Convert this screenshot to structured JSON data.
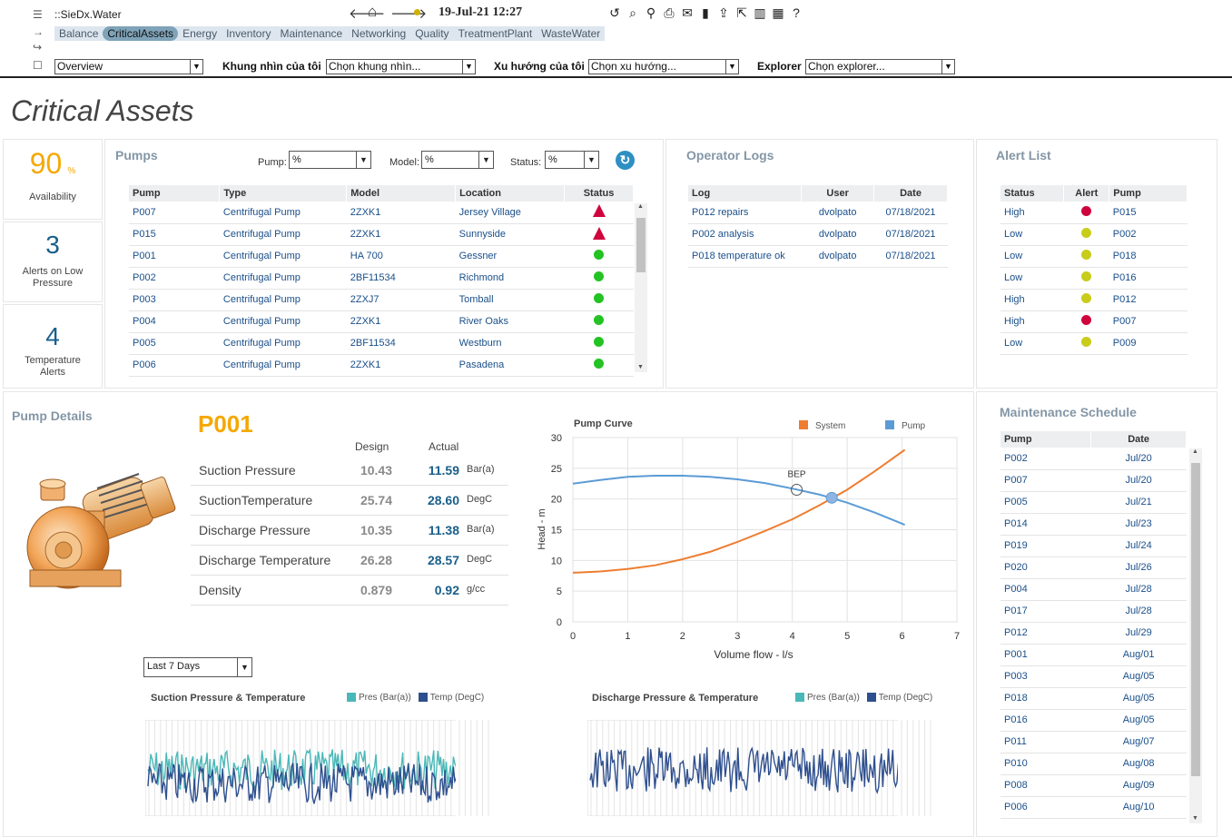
{
  "app": {
    "title": "::SieDx.Water",
    "datetime": "19-Jul-21 12:27"
  },
  "tabs": [
    "Balance",
    "CriticalAssets",
    "Energy",
    "Inventory",
    "Maintenance",
    "Networking",
    "Quality",
    "TreatmentPlant",
    "WasteWater"
  ],
  "active_tab": "CriticalAssets",
  "toolbar_icons": [
    "undo-icon",
    "search-zoom-icon",
    "pin-icon",
    "print-icon",
    "mail-icon",
    "trash-icon",
    "upload-icon",
    "export-icon",
    "chart-icon",
    "grid-icon",
    "help-icon"
  ],
  "selectors": {
    "view": "Overview",
    "my_view_label": "Khung nhìn của tôi",
    "my_view": "Chọn khung nhìn...",
    "trend_label": "Xu hướng của tôi",
    "trend": "Chọn xu hướng...",
    "explorer_label": "Explorer",
    "explorer": "Chọn explorer..."
  },
  "page_title": "Critical Assets",
  "kpis": [
    {
      "value": "90",
      "unit": "%",
      "label": "Availability",
      "color": "#f5a800"
    },
    {
      "value": "3",
      "label": "Alerts on Low Pressure",
      "color": "#1a5f8a"
    },
    {
      "value": "4",
      "label": "Temperature Alerts",
      "color": "#1a5f8a"
    }
  ],
  "pumps": {
    "title": "Pumps",
    "filters": {
      "pump_label": "Pump:",
      "pump": "%",
      "model_label": "Model:",
      "model": "%",
      "status_label": "Status:",
      "status": "%"
    },
    "columns": [
      "Pump",
      "Type",
      "Model",
      "Location",
      "Status"
    ],
    "rows": [
      [
        "P007",
        "Centrifugal Pump",
        "2ZXK1",
        "Jersey Village",
        "alert"
      ],
      [
        "P015",
        "Centrifugal Pump",
        "2ZXK1",
        "Sunnyside",
        "alert"
      ],
      [
        "P001",
        "Centrifugal Pump",
        "HA 700",
        "Gessner",
        "ok"
      ],
      [
        "P002",
        "Centrifugal Pump",
        "2BF11534",
        "Richmond",
        "ok"
      ],
      [
        "P003",
        "Centrifugal Pump",
        "2ZXJ7",
        "Tomball",
        "ok"
      ],
      [
        "P004",
        "Centrifugal Pump",
        "2ZXK1",
        "River Oaks",
        "ok"
      ],
      [
        "P005",
        "Centrifugal Pump",
        "2BF11534",
        "Westburn",
        "ok"
      ],
      [
        "P006",
        "Centrifugal Pump",
        "2ZXK1",
        "Pasadena",
        "ok"
      ]
    ]
  },
  "operator_logs": {
    "title": "Operator Logs",
    "columns": [
      "Log",
      "User",
      "Date"
    ],
    "rows": [
      [
        "P012 repairs",
        "dvolpato",
        "07/18/2021"
      ],
      [
        "P002 analysis",
        "dvolpato",
        "07/18/2021"
      ],
      [
        "P018 temperature ok",
        "dvolpato",
        "07/18/2021"
      ]
    ]
  },
  "alert_list": {
    "title": "Alert List",
    "columns": [
      "Status",
      "Alert",
      "Pump"
    ],
    "rows": [
      [
        "High",
        "#d0043c",
        "P015"
      ],
      [
        "Low",
        "#c8cc1a",
        "P002"
      ],
      [
        "Low",
        "#c8cc1a",
        "P018"
      ],
      [
        "Low",
        "#c8cc1a",
        "P016"
      ],
      [
        "High",
        "#c8cc1a",
        "P012"
      ],
      [
        "High",
        "#d0043c",
        "P007"
      ],
      [
        "Low",
        "#c8cc1a",
        "P009"
      ]
    ]
  },
  "pump_details": {
    "title": "Pump Details",
    "pump_id": "P001",
    "col_design": "Design",
    "col_actual": "Actual",
    "rows": [
      {
        "label": "Suction Pressure",
        "design": "10.43",
        "actual": "11.59",
        "unit": "Bar(a)"
      },
      {
        "label": "SuctionTemperature",
        "design": "25.74",
        "actual": "28.60",
        "unit": "DegC"
      },
      {
        "label": "Discharge Pressure",
        "design": "10.35",
        "actual": "11.38",
        "unit": "Bar(a)"
      },
      {
        "label": "Discharge Temperature",
        "design": "26.28",
        "actual": "28.57",
        "unit": "DegC"
      },
      {
        "label": "Density",
        "design": "0.879",
        "actual": "0.92",
        "unit": "g/cc"
      }
    ],
    "range": "Last 7 Days"
  },
  "maintenance": {
    "title": "Maintenance Schedule",
    "columns": [
      "Pump",
      "Date"
    ],
    "rows": [
      [
        "P002",
        "Jul/20"
      ],
      [
        "P007",
        "Jul/20"
      ],
      [
        "P005",
        "Jul/21"
      ],
      [
        "P014",
        "Jul/23"
      ],
      [
        "P019",
        "Jul/24"
      ],
      [
        "P020",
        "Jul/26"
      ],
      [
        "P004",
        "Jul/28"
      ],
      [
        "P017",
        "Jul/28"
      ],
      [
        "P012",
        "Jul/29"
      ],
      [
        "P001",
        "Aug/01"
      ],
      [
        "P003",
        "Aug/05"
      ],
      [
        "P018",
        "Aug/05"
      ],
      [
        "P016",
        "Aug/05"
      ],
      [
        "P011",
        "Aug/07"
      ],
      [
        "P010",
        "Aug/08"
      ],
      [
        "P008",
        "Aug/09"
      ],
      [
        "P006",
        "Aug/10"
      ]
    ]
  },
  "chart_data": [
    {
      "type": "line",
      "title": "Pump Curve",
      "xlabel": "Volume flow - l/s",
      "ylabel": "Head - m",
      "xlim": [
        0,
        7
      ],
      "ylim": [
        0,
        30
      ],
      "xticks": [
        0,
        1,
        2,
        3,
        4,
        5,
        6,
        7
      ],
      "yticks": [
        0,
        5,
        10,
        15,
        20,
        25,
        30
      ],
      "series": [
        {
          "name": "System",
          "color": "#ee7d31",
          "x": [
            0,
            0.5,
            1,
            1.5,
            2,
            2.5,
            3,
            3.5,
            4,
            4.5,
            5,
            5.5,
            6.05
          ],
          "y": [
            8,
            8.2,
            8.6,
            9.2,
            10.2,
            11.4,
            13,
            14.8,
            16.7,
            19,
            21.5,
            24.5,
            28
          ]
        },
        {
          "name": "Pump",
          "color": "#5b9bd5",
          "x": [
            0,
            0.5,
            1,
            1.5,
            2,
            2.5,
            3,
            3.5,
            4,
            4.5,
            5,
            5.5,
            6.05
          ],
          "y": [
            22.5,
            23.1,
            23.6,
            23.8,
            23.8,
            23.6,
            23.2,
            22.6,
            21.7,
            20.7,
            19.4,
            17.8,
            15.8
          ]
        }
      ],
      "annotations": [
        {
          "label": "BEP",
          "x": 4.08,
          "y": 21.5
        },
        {
          "label": "",
          "x": 4.72,
          "y": 20.2
        }
      ],
      "grid": true,
      "legend": "top"
    },
    {
      "type": "area",
      "title": "Suction Pressure & Temperature",
      "series": [
        {
          "name": "Pres (Bar(a))",
          "color": "#4ab8b8"
        },
        {
          "name": "Temp (DegC)",
          "color": "#2e4f8e"
        }
      ]
    },
    {
      "type": "area",
      "title": "Discharge Pressure & Temperature",
      "series": [
        {
          "name": "Pres (Bar(a))",
          "color": "#4ab8b8"
        },
        {
          "name": "Temp (DegC)",
          "color": "#2e4f8e"
        }
      ]
    }
  ]
}
